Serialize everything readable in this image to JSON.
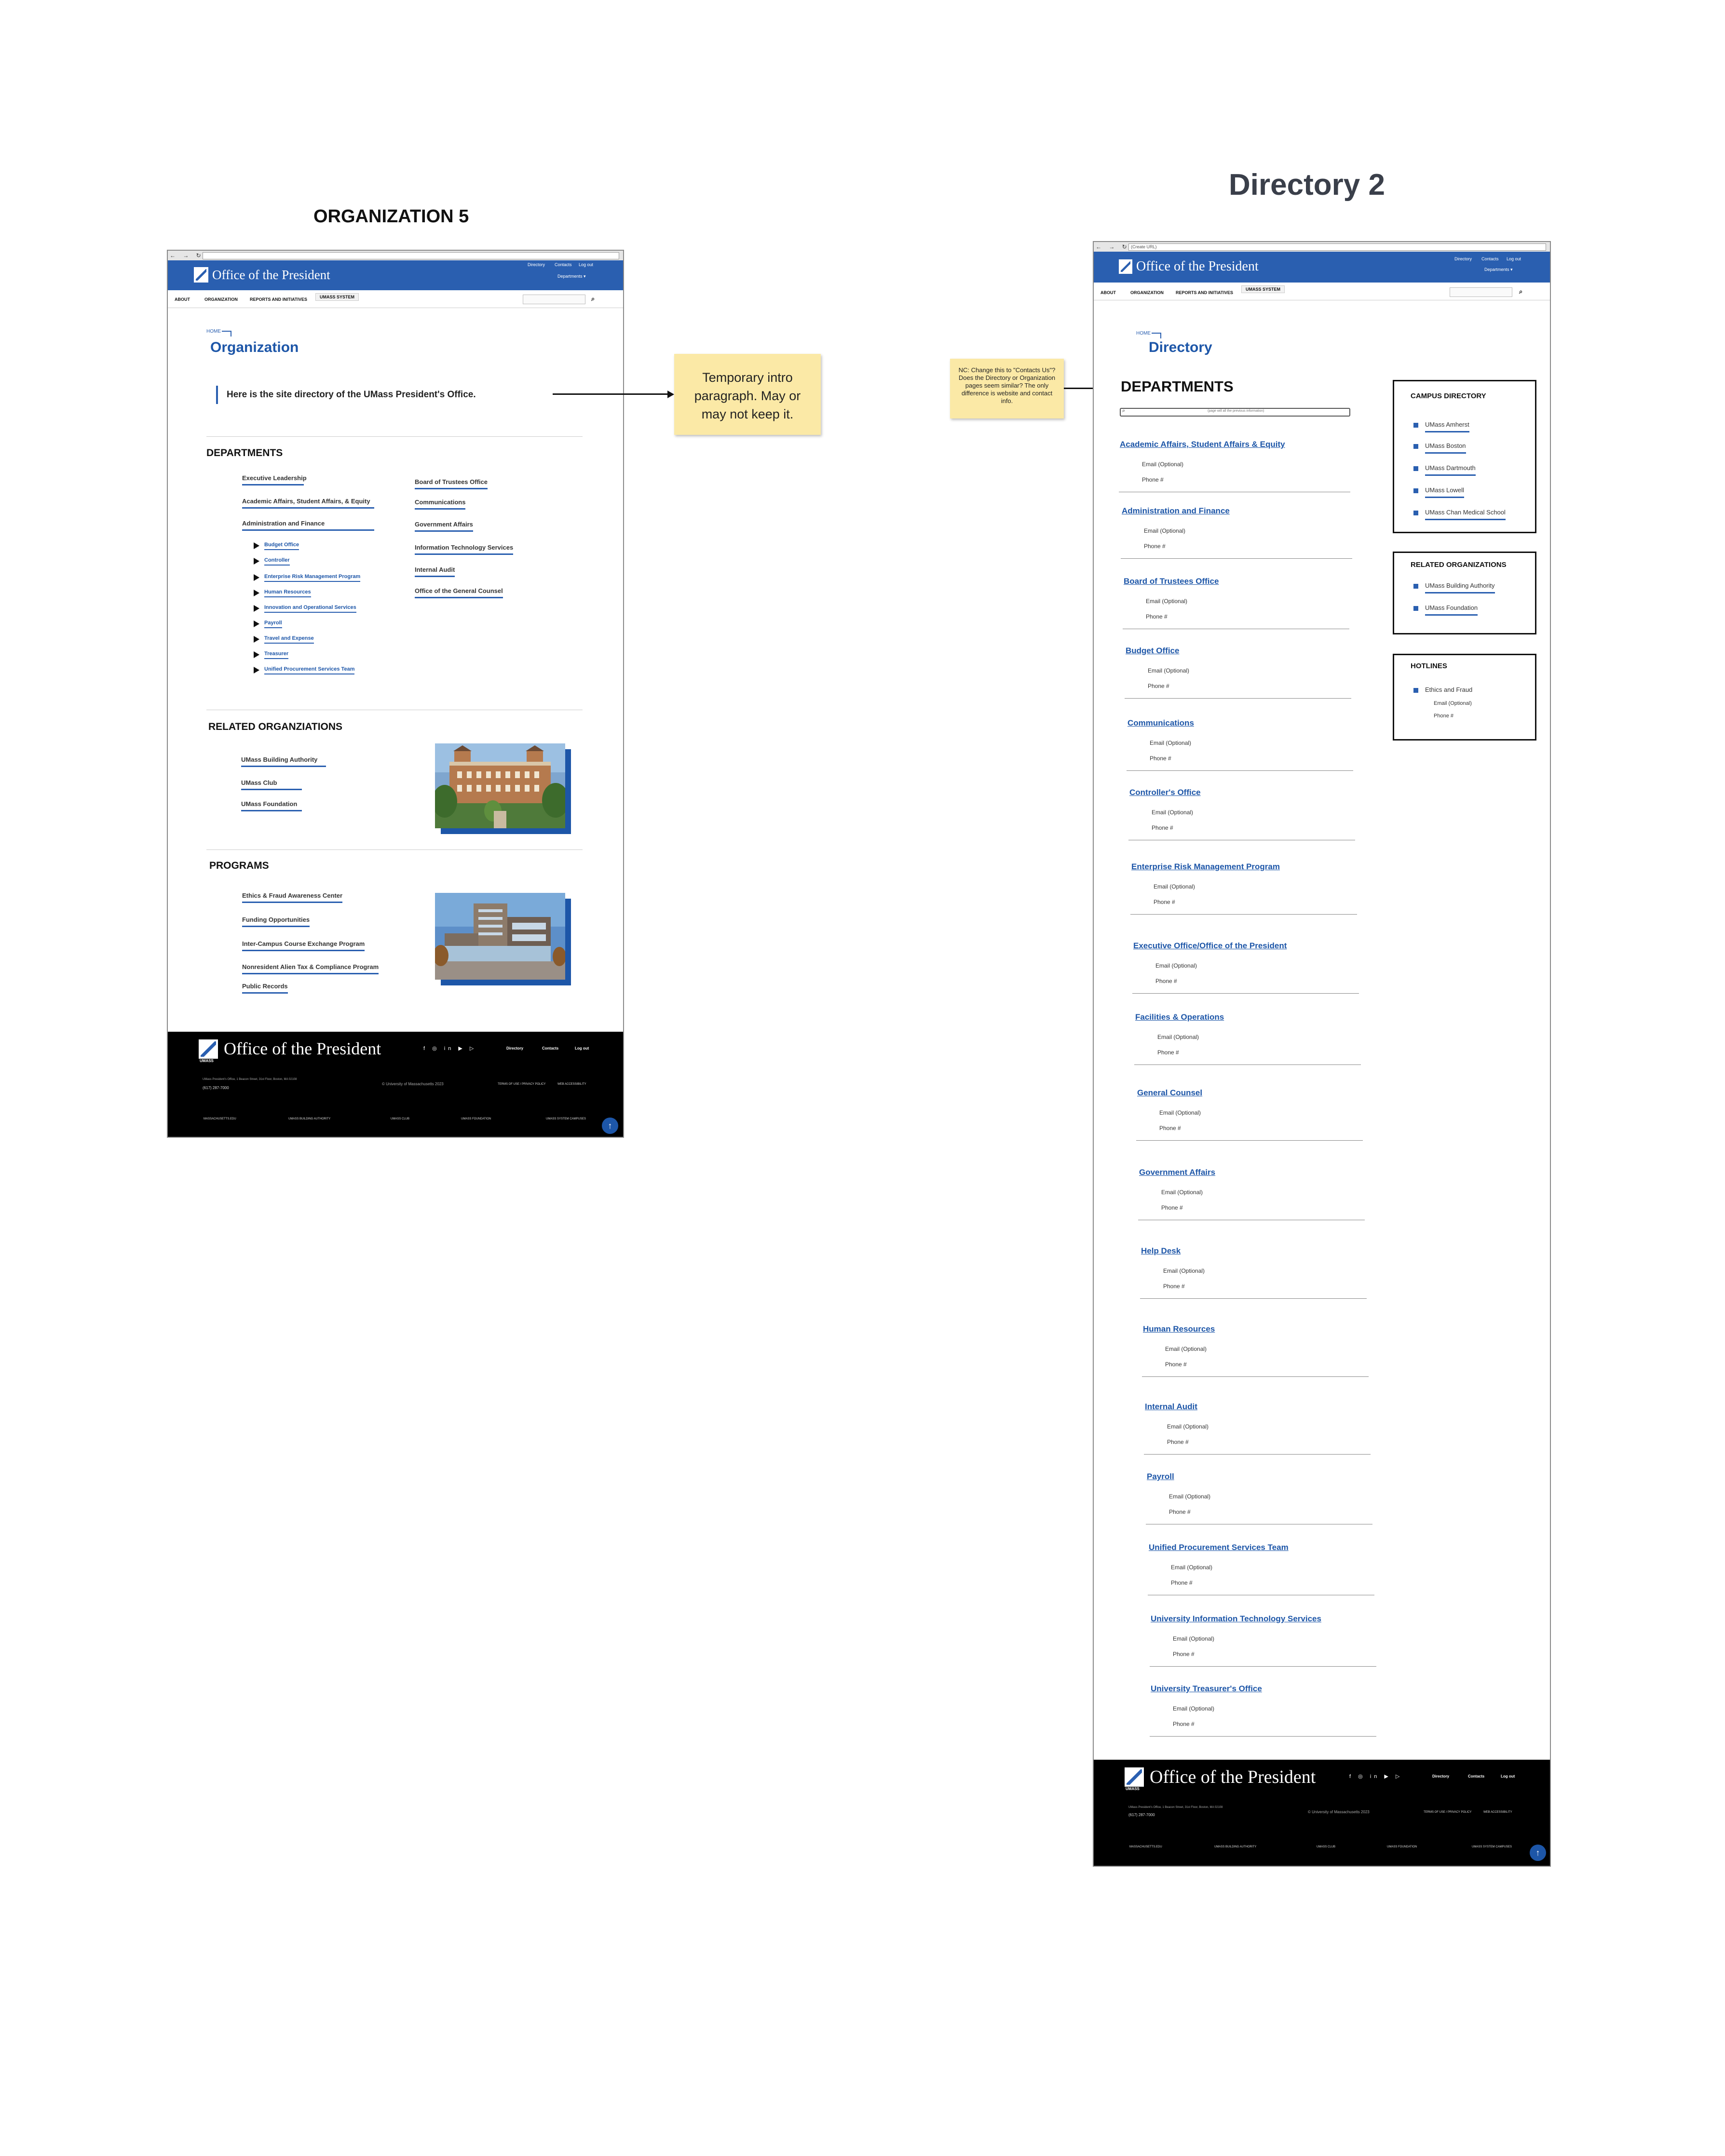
{
  "boards": {
    "left_title": "ORGANIZATION 5",
    "right_title": "Directory 2"
  },
  "chrome": {
    "nav_glyphs": "← → ↻ ⌂",
    "right_url": "(Create URL)"
  },
  "header": {
    "site_title": "Office of the President",
    "util_directory": "Directory",
    "util_contacts": "Contacts",
    "util_login": "Log out",
    "util_departments": "Departments",
    "dropdown_glyph": "▾"
  },
  "nav": {
    "about": "ABOUT",
    "organization": "ORGANIZATION",
    "reports": "REPORTS AND INITIATIVES",
    "umass_system": "UMASS SYSTEM",
    "search_glyph": "⌕"
  },
  "org": {
    "breadcrumb": "HOME",
    "page_title": "Organization",
    "intro": "Here is the site directory of the UMass President's Office.",
    "departments_heading": "DEPARTMENTS",
    "dept_left": [
      "Executive Leadership",
      "Academic Affairs, Student Affairs, & Equity",
      "Administration and Finance"
    ],
    "dept_sub": [
      "Budget Office",
      "Controller",
      "Enterprise Risk Management Program",
      "Human Resources",
      "Innovation and Operational Services",
      "Payroll",
      "Travel and Expense",
      "Treasurer",
      "Unified Procurement Services Team"
    ],
    "dept_right": [
      "Board of Trustees Office",
      "Communications",
      "Government Affairs",
      "Information Technology Services",
      "Internal Audit",
      "Office of the General Counsel"
    ],
    "related_heading": "RELATED ORGANZIATIONS",
    "related": [
      "UMass Building Authority",
      "UMass Club",
      "UMass Foundation"
    ],
    "programs_heading": "PROGRAMS",
    "programs": [
      "Ethics & Fraud Awareness Center",
      "Funding Opportunities",
      "Inter-Campus Course Exchange Program",
      "Nonresident Alien Tax & Compliance Program",
      "Public Records"
    ]
  },
  "footer": {
    "title": "Office of the President",
    "wordmark": "UMASS",
    "social": "f ◎ in ▶ ▷",
    "directory": "Directory",
    "contacts": "Contacts",
    "login": "Log out",
    "address_line1": "UMass President's Office, 1 Beacon Street, 31st Floor, Boston, MA 02108",
    "address_line2": "(617) 287-7000",
    "copyright": "© University of Massachusetts 2023",
    "terms": "TERMS OF USE / PRIVACY POLICY",
    "web_access": "WEB ACCESSIBILITY",
    "bottom_links": [
      "MASSACHUSETTS.EDU",
      "UMASS BUILDING AUTHORITY",
      "UMASS CLUB",
      "UMASS FOUNDATION",
      "UMASS SYSTEM CAMPUSES"
    ],
    "top_glyph": "↑"
  },
  "notes": {
    "intro_note": "Temporary intro paragraph. May or may not keep it.",
    "contacts_note": "NC: Change this to \"Contacts Us\"? Does the Directory or Organization pages seem similar? The only difference is website and contact info."
  },
  "dir": {
    "breadcrumb": "HOME",
    "page_title": "Directory",
    "departments_heading": "DEPARTMENTS",
    "search_placeholder": "(page will all the previous information)",
    "email_label": "Email (Optional)",
    "phone_label": "Phone #",
    "departments": [
      "Academic Affairs, Student Affairs & Equity",
      "Administration and Finance",
      "Board of Trustees Office",
      "Budget Office",
      "Communications",
      "Controller's Office",
      "Enterprise Risk Management Program",
      "Executive Office/Office of the President",
      "Facilities & Operations",
      "General Counsel",
      "Government Affairs",
      "Help Desk",
      "Human Resources",
      "Internal Audit",
      "Payroll",
      "Unified Procurement Services Team",
      "University Information Technology Services",
      "University Treasurer's Office"
    ],
    "campus_heading": "CAMPUS DIRECTORY",
    "campuses": [
      "UMass Amherst",
      "UMass Boston",
      "UMass Dartmouth",
      "UMass Lowell",
      "UMass Chan Medical School"
    ],
    "related_heading": "RELATED ORGANIZATIONS",
    "related": [
      "UMass Building Authority",
      "UMass Foundation"
    ],
    "hotlines_heading": "HOTLINES",
    "hotline": "Ethics and Fraud",
    "hotline_email": "Email (Optional)",
    "hotline_phone": "Phone #"
  }
}
